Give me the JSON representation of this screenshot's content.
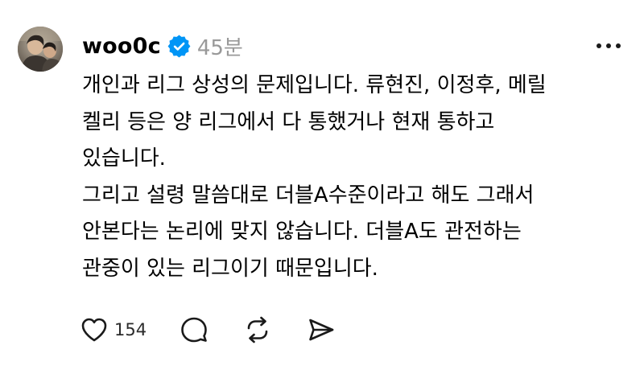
{
  "post": {
    "username": "woo0c",
    "time": "45분",
    "lines": [
      "개인과 리그 상성의 문제입니다. 류현진, 이정후, 메릴",
      "켈리 등은 양 리그에서 다 통했거나 현재 통하고",
      "있습니다.",
      "그리고 설령 말씀대로 더블A수준이라고 해도 그래서",
      "안본다는 논리에 맞지 않습니다. 더블A도 관전하는",
      "관중이 있는 리그이기 때문입니다."
    ],
    "like_count": "154"
  },
  "icons": {
    "verified": "verified-badge-icon",
    "more": "more-options-icon",
    "like": "heart-icon",
    "comment": "comment-icon",
    "repost": "repost-icon",
    "share": "share-icon"
  },
  "colors": {
    "verified_badge": "#0095f6",
    "timestamp": "#999999",
    "icon_stroke": "#1a1a1a"
  }
}
